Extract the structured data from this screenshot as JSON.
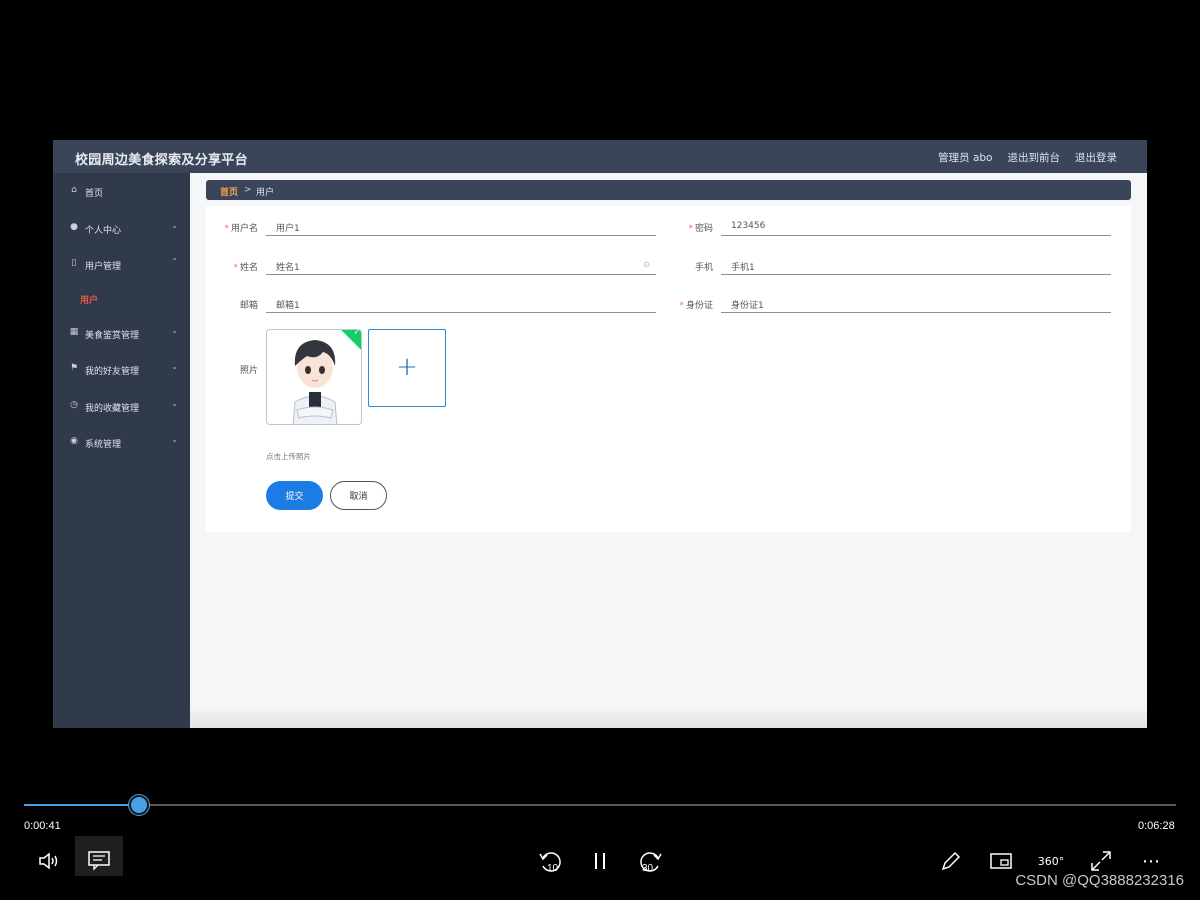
{
  "app": {
    "title": "校园周边美食探索及分享平台"
  },
  "header": {
    "user": "管理员 abo",
    "to_front": "退出到前台",
    "logout": "退出登录"
  },
  "sidebar": {
    "items": [
      {
        "label": "首页",
        "icon": "home-icon"
      },
      {
        "label": "个人中心",
        "icon": "user-icon"
      },
      {
        "label": "用户管理",
        "icon": "phone-icon"
      },
      {
        "label": "美食鉴赏管理",
        "icon": "grid-icon"
      },
      {
        "label": "我的好友管理",
        "icon": "flag-icon"
      },
      {
        "label": "我的收藏管理",
        "icon": "clock-icon"
      },
      {
        "label": "系统管理",
        "icon": "compass-icon"
      }
    ],
    "sub_active": "用户"
  },
  "breadcrumb": {
    "home": "首页",
    "separator": ">",
    "current": "用户"
  },
  "form": {
    "username": {
      "label": "用户名",
      "value": "用户1"
    },
    "password": {
      "label": "密码",
      "value": "123456"
    },
    "name": {
      "label": "姓名",
      "value": "姓名1"
    },
    "phone": {
      "label": "手机",
      "value": "手机1"
    },
    "email": {
      "label": "邮箱",
      "value": "邮箱1"
    },
    "idcard": {
      "label": "身份证",
      "value": "身份证1"
    },
    "photo": {
      "label": "照片",
      "hint": "点击上传照片"
    },
    "submit": "提交",
    "cancel": "取消"
  },
  "player": {
    "current_time": "0:00:41",
    "total_time": "0:06:28",
    "progress": 0.1,
    "skip_back": "10",
    "skip_forward": "30",
    "view360": "360°",
    "accent": "#4a9ee6"
  },
  "watermark": "CSDN @QQ3888232316"
}
